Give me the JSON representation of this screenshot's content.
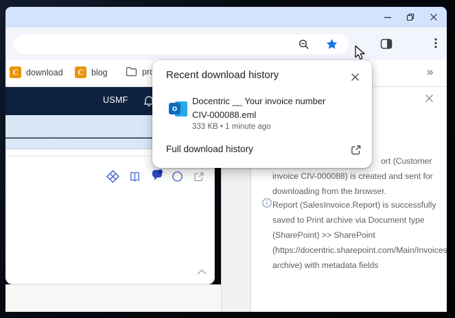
{
  "colors": {
    "titlebar": "#d3e3fd",
    "toolbar": "#f2f5fc",
    "accent_blue": "#1a73e8",
    "navy_header": "#0e2240",
    "light_blue_row": "#d9e7f7",
    "panel_text": "#605e5c",
    "bookmark_favicon_orange": "#e8940c",
    "outlook_blue": "#0f6cbd",
    "outlook_light_blue": "#28a8ea"
  },
  "bookmarks_bar": {
    "items": [
      {
        "label": "download",
        "favicon_glyph": "C"
      },
      {
        "label": "blog",
        "favicon_glyph": "C"
      },
      {
        "label": "pro",
        "icon": "folder-icon"
      }
    ],
    "overflow_glyph": "»"
  },
  "download_popup": {
    "title": "Recent download history",
    "item": {
      "name_line1": "Docentric __ Your invoice number",
      "name_line2": "CIV-000088.eml",
      "meta": "333 KB • 1 minute ago",
      "file_icon": "outlook-eml-icon",
      "outlook_glyph": "o"
    },
    "footer_link": "Full download history"
  },
  "app_header": {
    "company": "USMF"
  },
  "side_panel": {
    "messages": [
      {
        "icon": "info-icon",
        "lines": [
          "ort (Customer",
          "invoice CIV-000088) is created and sent for",
          "downloading from the browser."
        ]
      },
      {
        "icon": "info-icon",
        "lines": [
          "Report (SalesInvoice.Report) is successfully",
          "saved to Print archive via Document type",
          "(SharePoint) >> SharePoint",
          "(https://docentric.sharepoint.com/Main/Invoices/Tr",
          "archive) with metadata fields"
        ]
      }
    ]
  }
}
